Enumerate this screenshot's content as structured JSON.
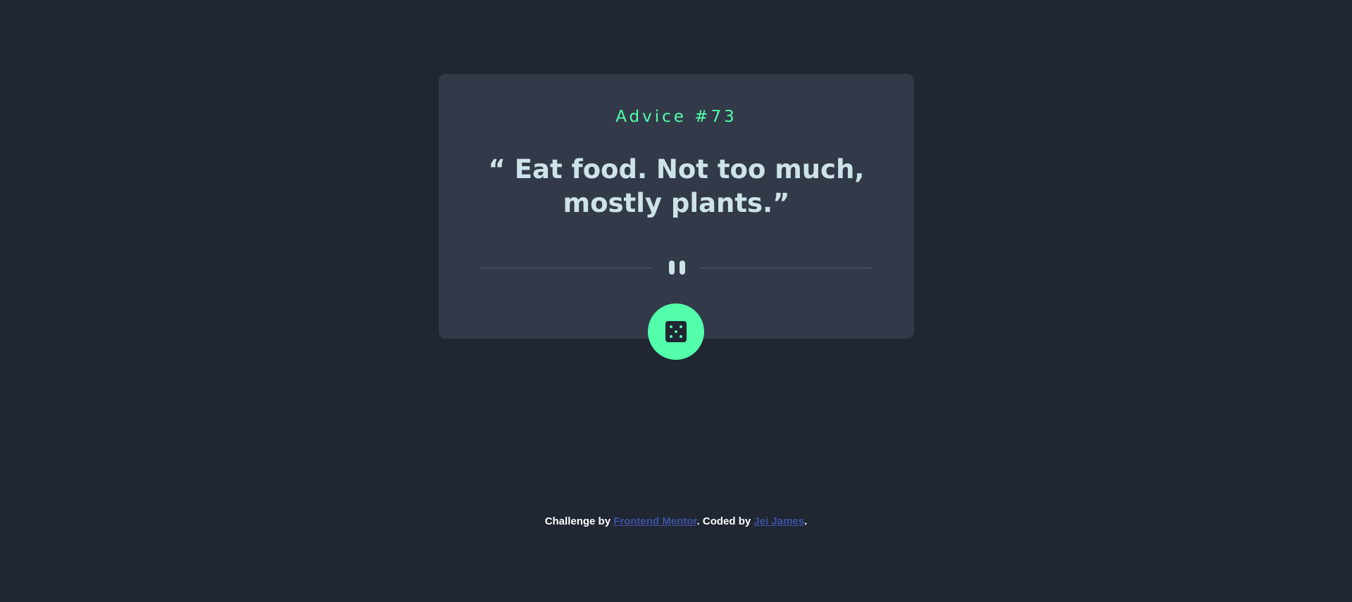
{
  "card": {
    "advice_label": "Advice #73",
    "advice_text": "“ Eat food. Not too much, mostly plants.”"
  },
  "dice_button": {
    "icon": "dice-icon",
    "accent_color": "#53ffaa"
  },
  "footer": {
    "prefix": "Challenge by ",
    "link1": "Frontend Mentor",
    "middle": ". Coded by ",
    "link2": "Jei James",
    "suffix": "."
  },
  "colors": {
    "background": "#202632",
    "card": "#323a49",
    "text": "#cee3e9",
    "accent": "#53ffaa",
    "link": "#3e52a3"
  }
}
